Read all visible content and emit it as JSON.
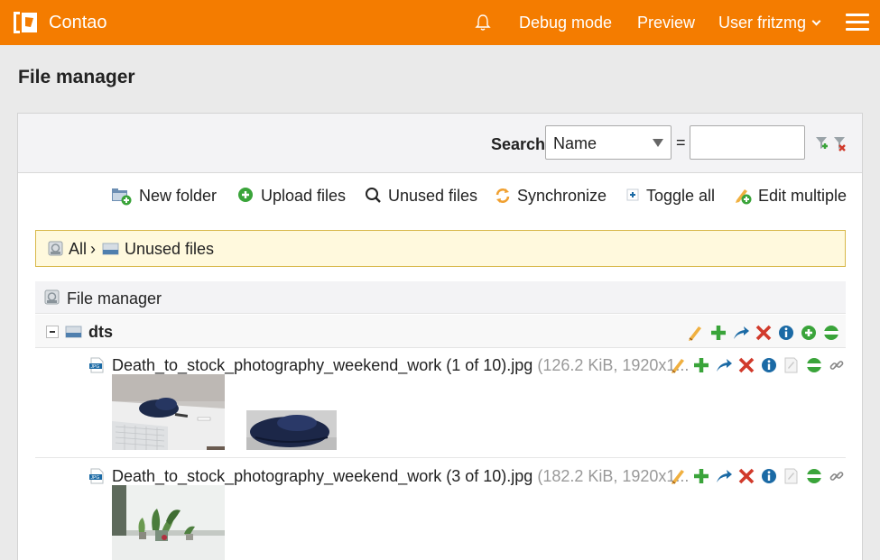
{
  "header": {
    "brand": "Contao",
    "nav": {
      "debug": "Debug mode",
      "preview": "Preview",
      "user": "User fritzmg"
    }
  },
  "page": {
    "title": "File manager"
  },
  "filter": {
    "search_label": "Search:",
    "field_value": "Name",
    "equals": "=",
    "input_value": ""
  },
  "actions": {
    "new_folder": "New folder",
    "upload": "Upload files",
    "unused": "Unused files",
    "sync": "Synchronize",
    "toggle": "Toggle all",
    "edit_multiple": "Edit multiple"
  },
  "breadcrumb": {
    "all": "All",
    "sep": "›",
    "current": "Unused files"
  },
  "tree": {
    "root": "File manager",
    "folder": "dts",
    "files": [
      {
        "name": "Death_to_stock_photography_weekend_work (1 of 10).jpg",
        "meta": "(126.2 KiB, 1920x1..."
      },
      {
        "name": "Death_to_stock_photography_weekend_work (3 of 10).jpg",
        "meta": "(182.2 KiB, 1920x1..."
      }
    ]
  },
  "colors": {
    "brand": "#f47c00",
    "breadcrumb_bg": "#fff9dd",
    "op_green": "#3aa43a",
    "op_red": "#d13a2b",
    "op_blue": "#1b6aa5"
  }
}
